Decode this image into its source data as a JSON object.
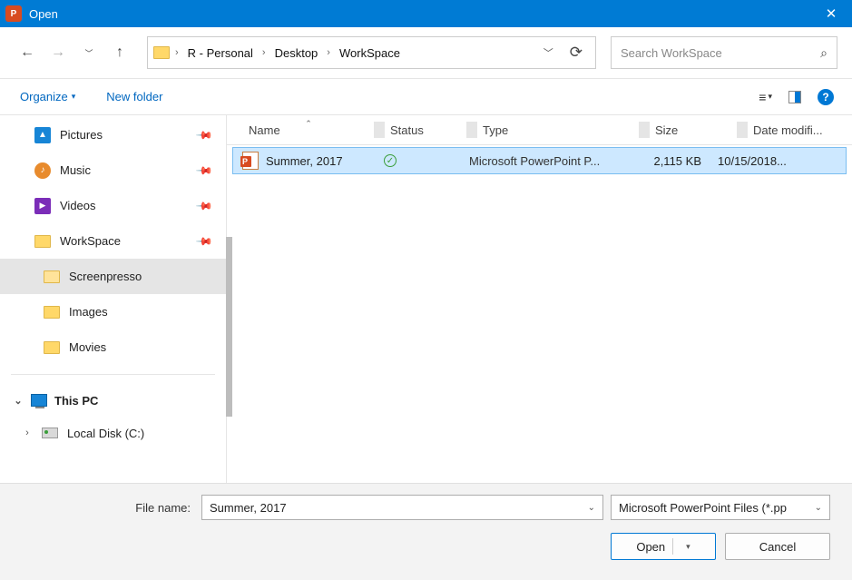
{
  "titlebar": {
    "title": "Open"
  },
  "breadcrumb": {
    "seg1": "R - Personal",
    "seg2": "Desktop",
    "seg3": "WorkSpace"
  },
  "search": {
    "placeholder": "Search WorkSpace"
  },
  "toolbar": {
    "organize": "Organize",
    "newfolder": "New folder"
  },
  "sidebar": {
    "items": [
      {
        "label": "Pictures",
        "pinned": true
      },
      {
        "label": "Music",
        "pinned": true
      },
      {
        "label": "Videos",
        "pinned": true
      },
      {
        "label": "WorkSpace",
        "pinned": true
      }
    ],
    "subitems": [
      {
        "label": "Screenpresso",
        "selected": true
      },
      {
        "label": "Images"
      },
      {
        "label": "Movies"
      }
    ],
    "thispc": "This PC",
    "localdisk": "Local Disk (C:)"
  },
  "columns": {
    "name": "Name",
    "status": "Status",
    "type": "Type",
    "size": "Size",
    "date": "Date modifi..."
  },
  "files": [
    {
      "name": "Summer, 2017",
      "type": "Microsoft PowerPoint P...",
      "size": "2,115 KB",
      "date": "10/15/2018..."
    }
  ],
  "footer": {
    "filename_label": "File name:",
    "filename_value": "Summer, 2017",
    "filetype": "Microsoft PowerPoint Files (*.pp",
    "open": "Open",
    "cancel": "Cancel"
  }
}
